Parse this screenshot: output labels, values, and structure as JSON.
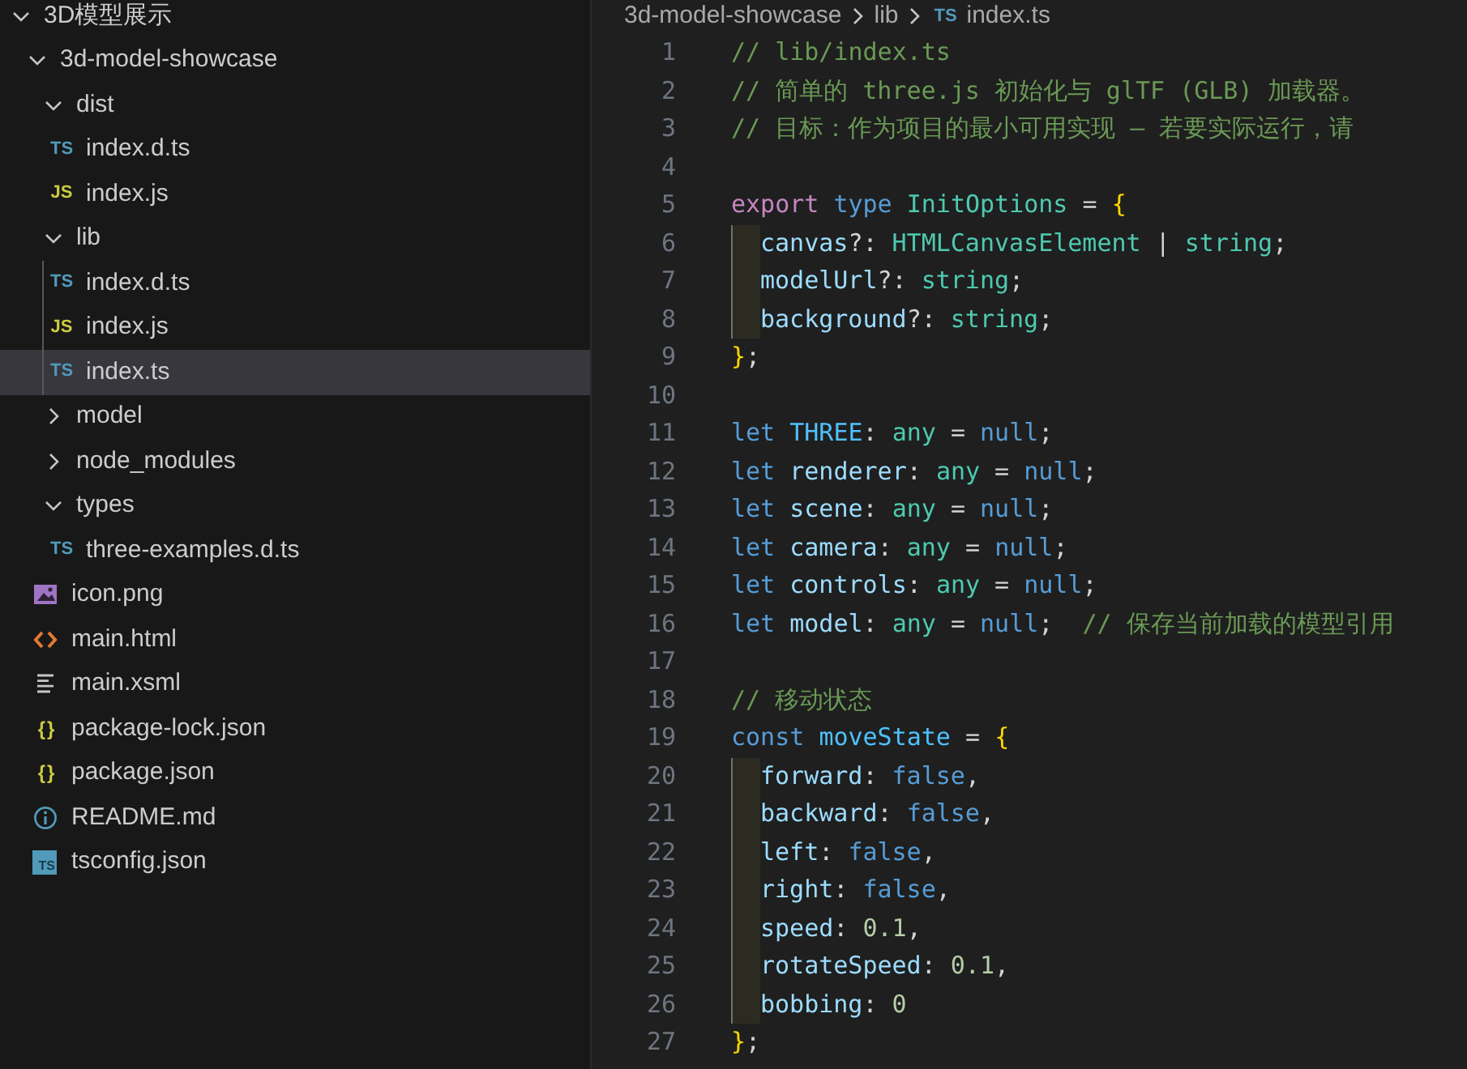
{
  "explorer": {
    "items": [
      {
        "label": "3D模型展示",
        "kind": "folder",
        "expanded": true,
        "children": [
          {
            "label": "3d-model-showcase",
            "kind": "folder",
            "expanded": true,
            "children": [
              {
                "label": "dist",
                "kind": "folder",
                "expanded": true,
                "children": [
                  {
                    "label": "index.d.ts",
                    "kind": "ts",
                    "icon_text": "TS",
                    "selected": false
                  },
                  {
                    "label": "index.js",
                    "kind": "js",
                    "icon_text": "JS",
                    "selected": false
                  }
                ]
              },
              {
                "label": "lib",
                "kind": "folder",
                "expanded": true,
                "children": [
                  {
                    "label": "index.d.ts",
                    "kind": "ts",
                    "icon_text": "TS",
                    "selected": false
                  },
                  {
                    "label": "index.js",
                    "kind": "js",
                    "icon_text": "JS",
                    "selected": false
                  },
                  {
                    "label": "index.ts",
                    "kind": "ts",
                    "icon_text": "TS",
                    "selected": true
                  }
                ]
              },
              {
                "label": "model",
                "kind": "folder",
                "expanded": false
              },
              {
                "label": "node_modules",
                "kind": "folder",
                "expanded": false
              },
              {
                "label": "types",
                "kind": "folder",
                "expanded": true,
                "children": [
                  {
                    "label": "three-examples.d.ts",
                    "kind": "ts",
                    "icon_text": "TS",
                    "selected": false
                  }
                ]
              },
              {
                "label": "icon.png",
                "kind": "image",
                "selected": false
              },
              {
                "label": "main.html",
                "kind": "html",
                "selected": false
              },
              {
                "label": "main.xsml",
                "kind": "text",
                "selected": false
              },
              {
                "label": "package-lock.json",
                "kind": "json",
                "icon_text": "{}",
                "selected": false
              },
              {
                "label": "package.json",
                "kind": "json",
                "icon_text": "{}",
                "selected": false
              },
              {
                "label": "README.md",
                "kind": "info",
                "selected": false
              },
              {
                "label": "tsconfig.json",
                "kind": "tsconfig",
                "icon_text": "TS",
                "selected": false
              }
            ]
          }
        ]
      }
    ]
  },
  "breadcrumb": {
    "parts": [
      "3d-model-showcase",
      "lib"
    ],
    "file_icon_text": "TS",
    "file": "index.ts"
  },
  "editor": {
    "lines": [
      {
        "number": "1",
        "indented": false,
        "tokens": [
          {
            "kind": "comment",
            "text": "// lib/index.ts"
          }
        ]
      },
      {
        "number": "2",
        "indented": false,
        "tokens": [
          {
            "kind": "comment",
            "text": "// 简单的 three.js 初始化与 glTF (GLB) 加载器。"
          }
        ]
      },
      {
        "number": "3",
        "indented": false,
        "tokens": [
          {
            "kind": "comment",
            "text": "// 目标：作为项目的最小可用实现 — 若要实际运行，请"
          }
        ]
      },
      {
        "number": "4",
        "indented": false
      },
      {
        "number": "5",
        "indented": false,
        "tokens": [
          {
            "kind": "control",
            "text": "export "
          },
          {
            "kind": "keyword",
            "text": "type "
          },
          {
            "kind": "type",
            "text": "InitOptions"
          },
          {
            "kind": "plain",
            "text": " = "
          },
          {
            "kind": "brace",
            "text": "{"
          }
        ]
      },
      {
        "number": "6",
        "indented": true,
        "tokens": [
          {
            "kind": "variable",
            "text": "canvas"
          },
          {
            "kind": "plain",
            "text": "?: "
          },
          {
            "kind": "type",
            "text": "HTMLCanvasElement"
          },
          {
            "kind": "plain",
            "text": " | "
          },
          {
            "kind": "type",
            "text": "string"
          },
          {
            "kind": "plain",
            "text": ";"
          }
        ]
      },
      {
        "number": "7",
        "indented": true,
        "tokens": [
          {
            "kind": "variable",
            "text": "modelUrl"
          },
          {
            "kind": "plain",
            "text": "?: "
          },
          {
            "kind": "type",
            "text": "string"
          },
          {
            "kind": "plain",
            "text": ";"
          }
        ]
      },
      {
        "number": "8",
        "indented": true,
        "tokens": [
          {
            "kind": "variable",
            "text": "background"
          },
          {
            "kind": "plain",
            "text": "?: "
          },
          {
            "kind": "type",
            "text": "string"
          },
          {
            "kind": "plain",
            "text": ";"
          }
        ]
      },
      {
        "number": "9",
        "indented": false,
        "tokens": [
          {
            "kind": "brace",
            "text": "}"
          },
          {
            "kind": "plain",
            "text": ";"
          }
        ]
      },
      {
        "number": "10",
        "indented": false
      },
      {
        "number": "11",
        "indented": false,
        "tokens": [
          {
            "kind": "keyword",
            "text": "let "
          },
          {
            "kind": "constant",
            "text": "THREE"
          },
          {
            "kind": "plain",
            "text": ": "
          },
          {
            "kind": "type",
            "text": "any"
          },
          {
            "kind": "plain",
            "text": " = "
          },
          {
            "kind": "keyword",
            "text": "null"
          },
          {
            "kind": "plain",
            "text": ";"
          }
        ]
      },
      {
        "number": "12",
        "indented": false,
        "tokens": [
          {
            "kind": "keyword",
            "text": "let "
          },
          {
            "kind": "variable",
            "text": "renderer"
          },
          {
            "kind": "plain",
            "text": ": "
          },
          {
            "kind": "type",
            "text": "any"
          },
          {
            "kind": "plain",
            "text": " = "
          },
          {
            "kind": "keyword",
            "text": "null"
          },
          {
            "kind": "plain",
            "text": ";"
          }
        ]
      },
      {
        "number": "13",
        "indented": false,
        "tokens": [
          {
            "kind": "keyword",
            "text": "let "
          },
          {
            "kind": "variable",
            "text": "scene"
          },
          {
            "kind": "plain",
            "text": ": "
          },
          {
            "kind": "type",
            "text": "any"
          },
          {
            "kind": "plain",
            "text": " = "
          },
          {
            "kind": "keyword",
            "text": "null"
          },
          {
            "kind": "plain",
            "text": ";"
          }
        ]
      },
      {
        "number": "14",
        "indented": false,
        "tokens": [
          {
            "kind": "keyword",
            "text": "let "
          },
          {
            "kind": "variable",
            "text": "camera"
          },
          {
            "kind": "plain",
            "text": ": "
          },
          {
            "kind": "type",
            "text": "any"
          },
          {
            "kind": "plain",
            "text": " = "
          },
          {
            "kind": "keyword",
            "text": "null"
          },
          {
            "kind": "plain",
            "text": ";"
          }
        ]
      },
      {
        "number": "15",
        "indented": false,
        "tokens": [
          {
            "kind": "keyword",
            "text": "let "
          },
          {
            "kind": "variable",
            "text": "controls"
          },
          {
            "kind": "plain",
            "text": ": "
          },
          {
            "kind": "type",
            "text": "any"
          },
          {
            "kind": "plain",
            "text": " = "
          },
          {
            "kind": "keyword",
            "text": "null"
          },
          {
            "kind": "plain",
            "text": ";"
          }
        ]
      },
      {
        "number": "16",
        "indented": false,
        "tokens": [
          {
            "kind": "keyword",
            "text": "let "
          },
          {
            "kind": "variable",
            "text": "model"
          },
          {
            "kind": "plain",
            "text": ": "
          },
          {
            "kind": "type",
            "text": "any"
          },
          {
            "kind": "plain",
            "text": " = "
          },
          {
            "kind": "keyword",
            "text": "null"
          },
          {
            "kind": "plain",
            "text": ";  "
          },
          {
            "kind": "comment",
            "text": "// 保存当前加载的模型引用"
          }
        ]
      },
      {
        "number": "17",
        "indented": false
      },
      {
        "number": "18",
        "indented": false,
        "tokens": [
          {
            "kind": "comment",
            "text": "// 移动状态"
          }
        ]
      },
      {
        "number": "19",
        "indented": false,
        "tokens": [
          {
            "kind": "keyword",
            "text": "const "
          },
          {
            "kind": "constant",
            "text": "moveState"
          },
          {
            "kind": "plain",
            "text": " = "
          },
          {
            "kind": "brace",
            "text": "{"
          }
        ]
      },
      {
        "number": "20",
        "indented": true,
        "tokens": [
          {
            "kind": "variable",
            "text": "forward"
          },
          {
            "kind": "plain",
            "text": ": "
          },
          {
            "kind": "keyword",
            "text": "false"
          },
          {
            "kind": "plain",
            "text": ","
          }
        ]
      },
      {
        "number": "21",
        "indented": true,
        "tokens": [
          {
            "kind": "variable",
            "text": "backward"
          },
          {
            "kind": "plain",
            "text": ": "
          },
          {
            "kind": "keyword",
            "text": "false"
          },
          {
            "kind": "plain",
            "text": ","
          }
        ]
      },
      {
        "number": "22",
        "indented": true,
        "tokens": [
          {
            "kind": "variable",
            "text": "left"
          },
          {
            "kind": "plain",
            "text": ": "
          },
          {
            "kind": "keyword",
            "text": "false"
          },
          {
            "kind": "plain",
            "text": ","
          }
        ]
      },
      {
        "number": "23",
        "indented": true,
        "tokens": [
          {
            "kind": "variable",
            "text": "right"
          },
          {
            "kind": "plain",
            "text": ": "
          },
          {
            "kind": "keyword",
            "text": "false"
          },
          {
            "kind": "plain",
            "text": ","
          }
        ]
      },
      {
        "number": "24",
        "indented": true,
        "tokens": [
          {
            "kind": "variable",
            "text": "speed"
          },
          {
            "kind": "plain",
            "text": ": "
          },
          {
            "kind": "number",
            "text": "0.1"
          },
          {
            "kind": "plain",
            "text": ","
          }
        ]
      },
      {
        "number": "25",
        "indented": true,
        "tokens": [
          {
            "kind": "variable",
            "text": "rotateSpeed"
          },
          {
            "kind": "plain",
            "text": ": "
          },
          {
            "kind": "number",
            "text": "0.1"
          },
          {
            "kind": "plain",
            "text": ","
          }
        ]
      },
      {
        "number": "26",
        "indented": true,
        "tokens": [
          {
            "kind": "variable",
            "text": "bobbing"
          },
          {
            "kind": "plain",
            "text": ": "
          },
          {
            "kind": "number",
            "text": "0"
          }
        ]
      },
      {
        "number": "27",
        "indented": false,
        "tokens": [
          {
            "kind": "brace",
            "text": "}"
          },
          {
            "kind": "plain",
            "text": ";"
          }
        ]
      }
    ]
  }
}
